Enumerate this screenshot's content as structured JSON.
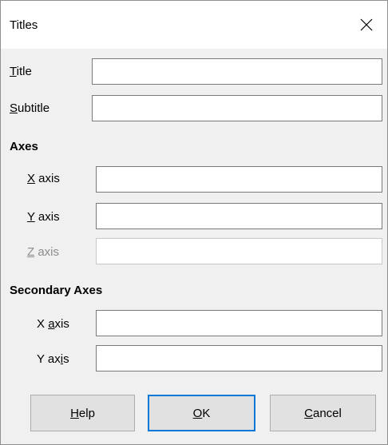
{
  "dialog": {
    "title": "Titles",
    "close_glyph": "✕"
  },
  "fields": {
    "title": {
      "label_key": "T",
      "label_rest": "itle",
      "value": ""
    },
    "subtitle": {
      "label_key": "S",
      "label_rest": "ubtitle",
      "value": ""
    }
  },
  "axes": {
    "heading": "Axes",
    "x": {
      "label_key": "X",
      "label_rest": " axis",
      "value": ""
    },
    "y": {
      "label_key": "Y",
      "label_rest": " axis",
      "value": ""
    },
    "z": {
      "label_key": "Z",
      "label_rest": " axis",
      "value": "",
      "disabled": true
    }
  },
  "secondary_axes": {
    "heading": "Secondary Axes",
    "x": {
      "label_pre": "X ",
      "label_key": "a",
      "label_rest": "xis",
      "value": ""
    },
    "y": {
      "label_pre": "Y ax",
      "label_key": "i",
      "label_rest": "s",
      "value": ""
    }
  },
  "buttons": {
    "help": {
      "key": "H",
      "rest": "elp"
    },
    "ok": {
      "key": "O",
      "rest": "K"
    },
    "cancel": {
      "key": "C",
      "rest": "ancel"
    }
  },
  "colors": {
    "window_bg": "#f0f0f0",
    "titlebar_bg": "#ffffff",
    "default_button_border": "#0078d7",
    "disabled_text": "#8c8c8c"
  },
  "icons": {
    "close": "close-icon"
  }
}
